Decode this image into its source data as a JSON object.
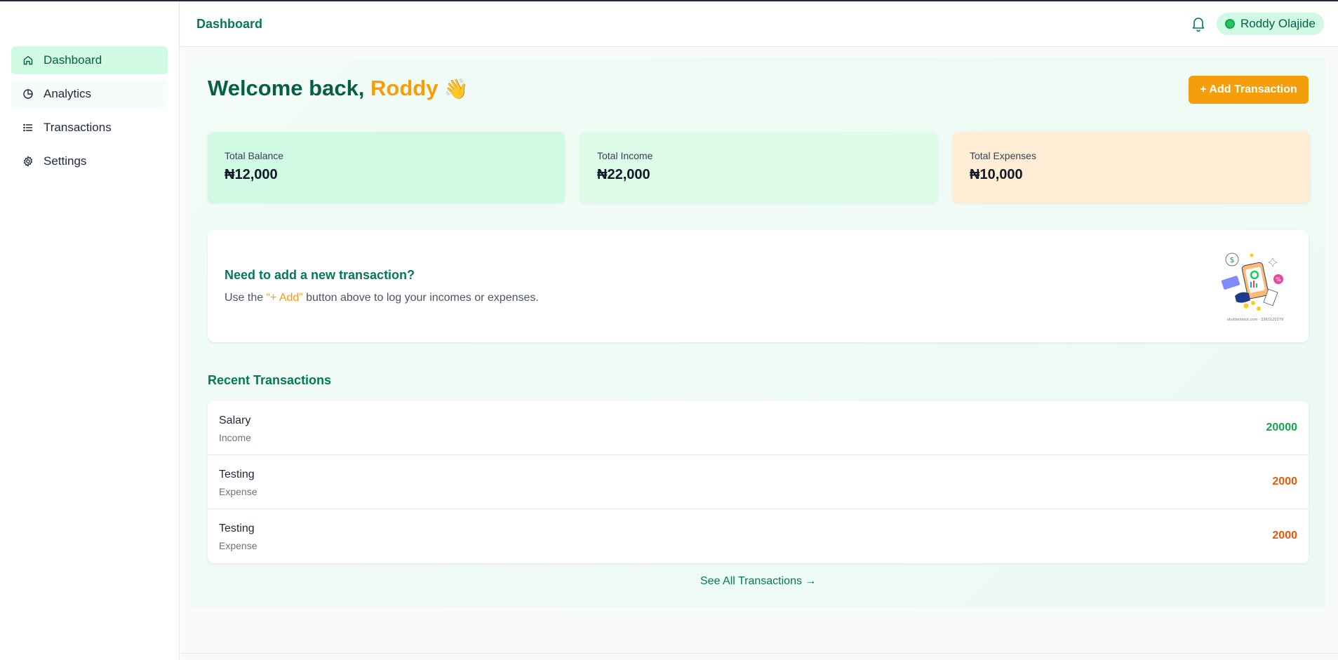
{
  "colors": {
    "brand": "#047857",
    "accent": "#f59e0b",
    "income": "#16a34a",
    "expense": "#ea580c"
  },
  "sidebar": {
    "items": [
      {
        "label": "Dashboard",
        "icon": "home-icon"
      },
      {
        "label": "Analytics",
        "icon": "pie-chart-icon"
      },
      {
        "label": "Transactions",
        "icon": "list-icon"
      },
      {
        "label": "Settings",
        "icon": "gear-icon"
      }
    ]
  },
  "header": {
    "title": "Dashboard",
    "user_name": "Roddy Olajide"
  },
  "welcome": {
    "prefix": "Welcome back, ",
    "name": "Roddy",
    "emoji": "👋"
  },
  "actions": {
    "add_transaction": "+ Add Transaction"
  },
  "cards": [
    {
      "label": "Total Balance",
      "value": "₦12,000"
    },
    {
      "label": "Total Income",
      "value": "₦22,000"
    },
    {
      "label": "Total Expenses",
      "value": "₦10,000"
    }
  ],
  "cta": {
    "title": "Need to add a new transaction?",
    "text_before": "Use the ",
    "text_highlight": "“+ Add”",
    "text_after": " button above to log your incomes or expenses.",
    "illustration_caption": "shutterstock.com · 2363120379"
  },
  "recent": {
    "title": "Recent Transactions",
    "transactions": [
      {
        "name": "Salary",
        "type": "Income",
        "amount": "20000"
      },
      {
        "name": "Testing",
        "type": "Expense",
        "amount": "2000"
      },
      {
        "name": "Testing",
        "type": "Expense",
        "amount": "2000"
      }
    ],
    "see_all": "See All Transactions →"
  }
}
